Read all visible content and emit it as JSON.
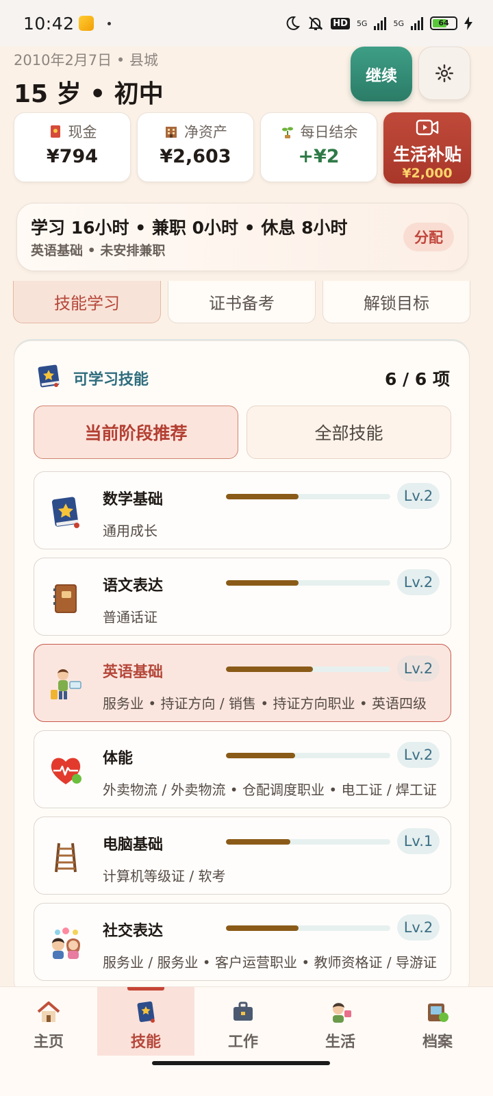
{
  "status_bar": {
    "time": "10:42",
    "network_left": "5G",
    "network_right": "5G",
    "hd_label": "HD",
    "battery": "64"
  },
  "header": {
    "date_location": "2010年2月7日 • 县城",
    "age_stage": "15 岁 • 初中",
    "continue_label": "继续",
    "settings_icon": "gear-icon"
  },
  "stats": [
    {
      "label": "现金",
      "value": "¥794",
      "icon": "red-envelope-icon"
    },
    {
      "label": "净资产",
      "value": "¥2,603",
      "icon": "building-icon"
    },
    {
      "label": "每日结余",
      "value": "+¥2",
      "icon": "sprout-icon"
    }
  ],
  "subsidy": {
    "title": "生活补贴",
    "amount": "¥2,000",
    "icon": "video-icon"
  },
  "schedule": {
    "line1": "学习 16小时 • 兼职 0小时 • 休息 8小时",
    "line2": "英语基础 • 未安排兼职",
    "allocate_label": "分配"
  },
  "top_tabs": [
    "技能学习",
    "证书备考",
    "解锁目标"
  ],
  "panel": {
    "title": "可学习技能",
    "count": "6 / 6 项",
    "filters": [
      "当前阶段推荐",
      "全部技能"
    ]
  },
  "skills": [
    {
      "name": "数学基础",
      "desc": "通用成长",
      "level": "Lv.2",
      "progress": 0.44,
      "icon": "star-book-icon"
    },
    {
      "name": "语文表达",
      "desc": "普通话证",
      "level": "Lv.2",
      "progress": 0.44,
      "icon": "notebook-icon"
    },
    {
      "name": "英语基础",
      "desc": "服务业 • 持证方向 / 销售 • 持证方向职业 • 英语四级",
      "level": "Lv.2",
      "progress": 0.53,
      "icon": "traveler-icon"
    },
    {
      "name": "体能",
      "desc": "外卖物流 / 外卖物流 • 仓配调度职业 • 电工证 / 焊工证",
      "level": "Lv.2",
      "progress": 0.42,
      "icon": "heart-icon"
    },
    {
      "name": "电脑基础",
      "desc": "计算机等级证 / 软考",
      "level": "Lv.1",
      "progress": 0.39,
      "icon": "ladder-icon"
    },
    {
      "name": "社交表达",
      "desc": "服务业 / 服务业 • 客户运营职业 • 教师资格证 / 导游证",
      "level": "Lv.2",
      "progress": 0.44,
      "icon": "chatting-people-icon"
    }
  ],
  "bottom_nav": [
    {
      "label": "主页",
      "icon": "house-icon"
    },
    {
      "label": "技能",
      "icon": "star-book-icon"
    },
    {
      "label": "工作",
      "icon": "briefcase-icon"
    },
    {
      "label": "生活",
      "icon": "person-icon"
    },
    {
      "label": "档案",
      "icon": "folder-icon"
    }
  ],
  "colors": {
    "accent_red": "#b5473a",
    "accent_green": "#2f7a47",
    "continue_green": "#2b7c67",
    "progress_brown": "#8a5b18"
  }
}
